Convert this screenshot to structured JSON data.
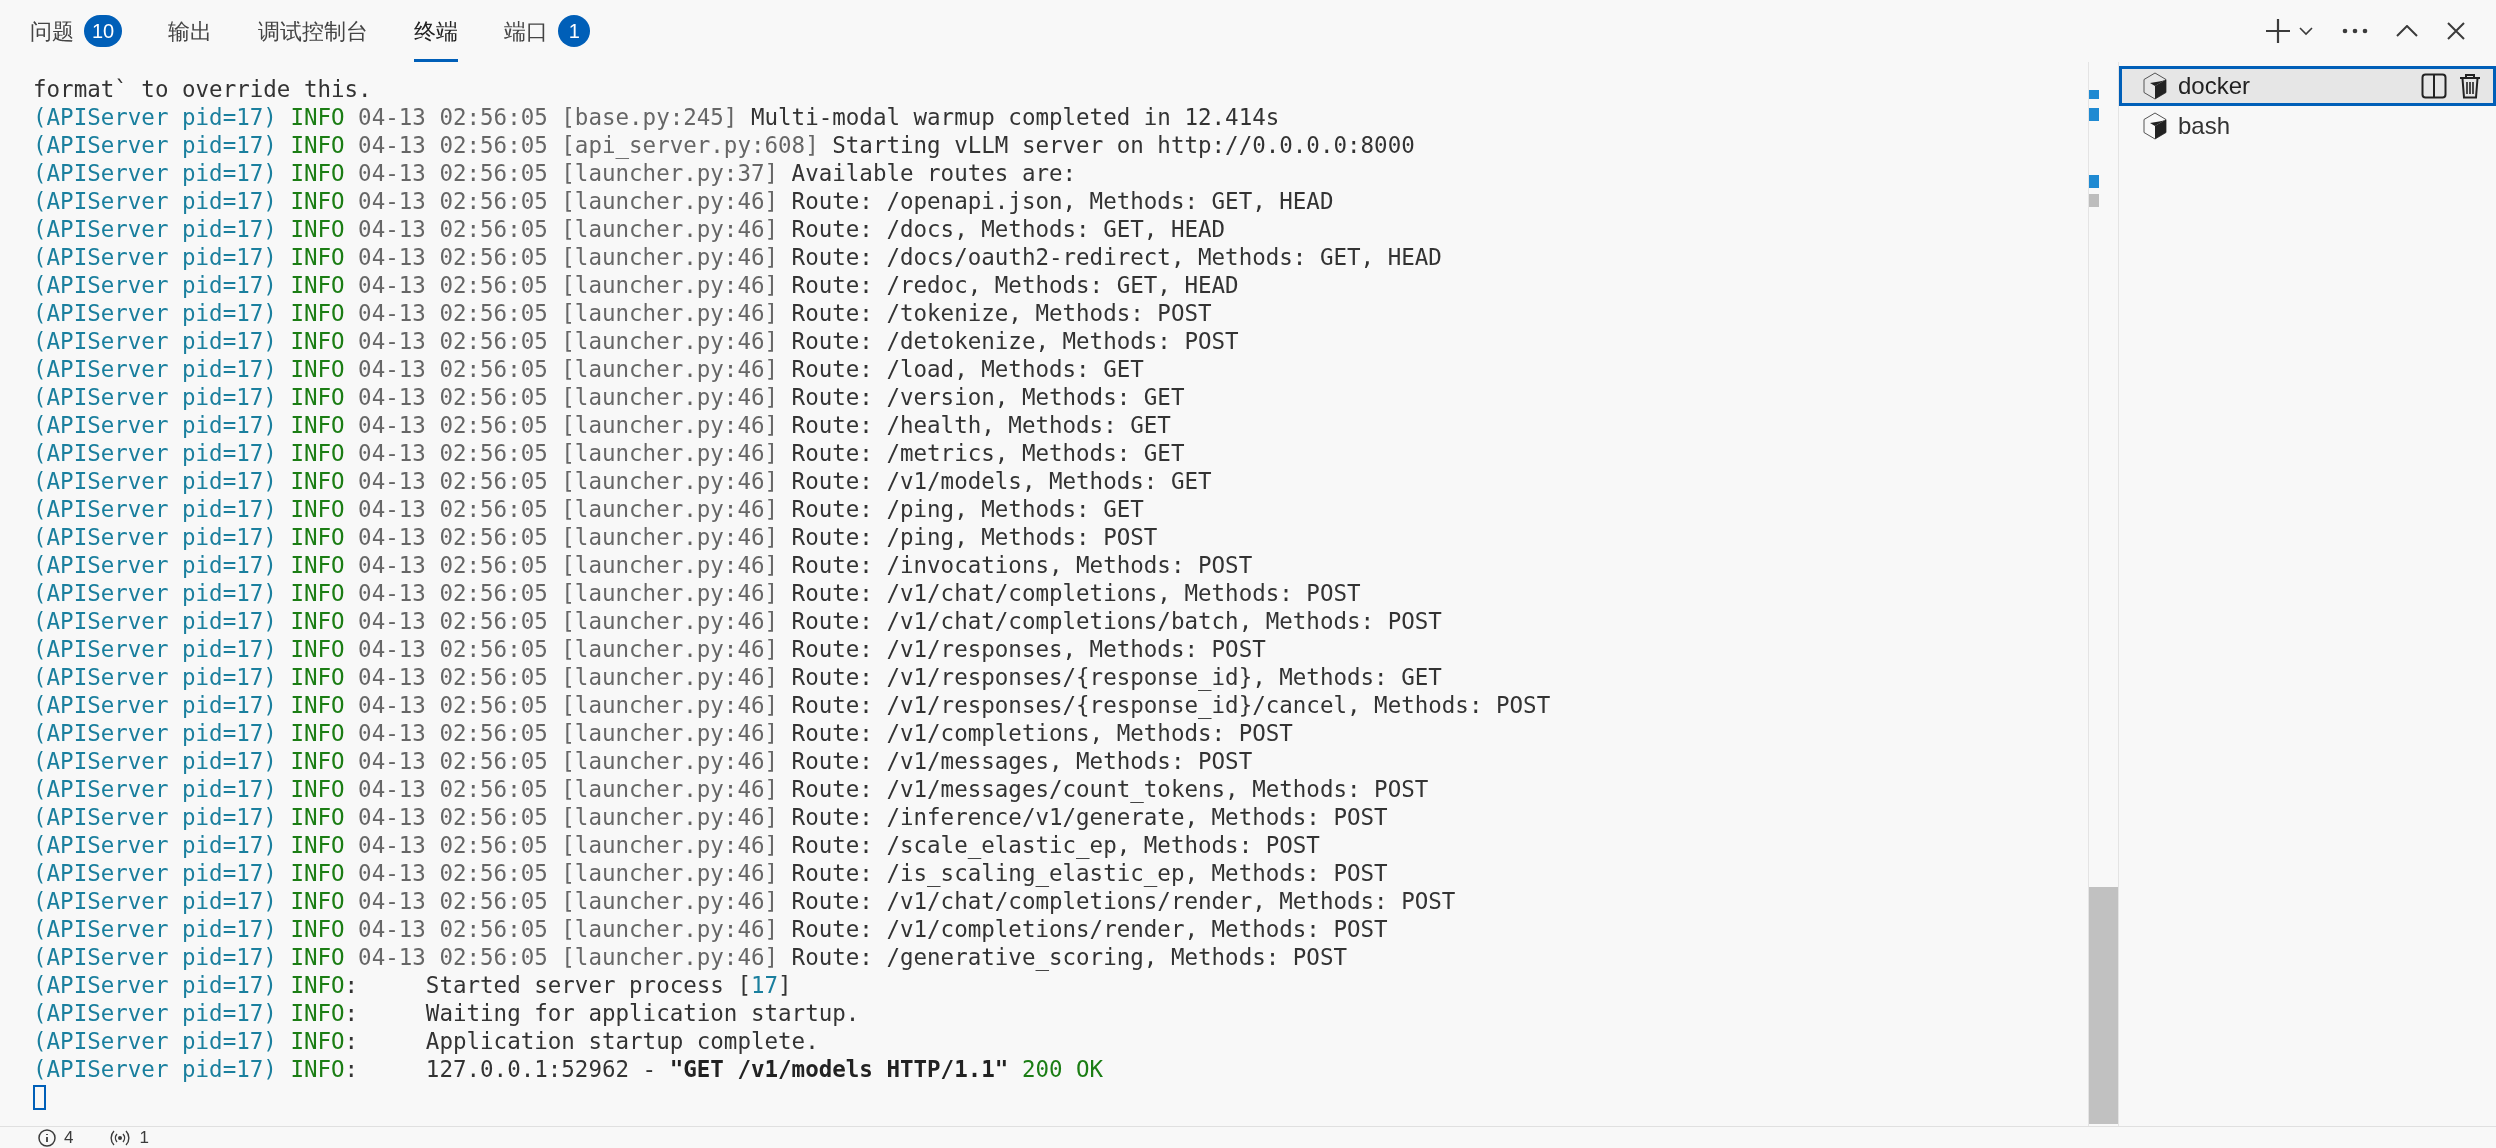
{
  "tabs": [
    {
      "label": "问题",
      "badge": "10",
      "selected": false
    },
    {
      "label": "输出",
      "selected": false
    },
    {
      "label": "调试控制台",
      "selected": false
    },
    {
      "label": "终端",
      "selected": true
    },
    {
      "label": "端口",
      "badge": "1",
      "selected": false
    }
  ],
  "terminal": {
    "lines": [
      [
        {
          "kind": "text",
          "text": "format` to override this."
        }
      ],
      [
        {
          "kind": "prefix",
          "text": "(APIServer pid=17) "
        },
        {
          "kind": "level",
          "text": "INFO"
        },
        {
          "kind": "meta",
          "text": " 04-13 02:56:05 [base.py:245]"
        },
        {
          "kind": "text",
          "text": " Multi-modal warmup completed in 12.414s"
        }
      ],
      [
        {
          "kind": "prefix",
          "text": "(APIServer pid=17) "
        },
        {
          "kind": "level",
          "text": "INFO"
        },
        {
          "kind": "meta",
          "text": " 04-13 02:56:05 [api_server.py:608]"
        },
        {
          "kind": "text",
          "text": " Starting vLLM server on http://0.0.0.0:8000"
        }
      ],
      [
        {
          "kind": "prefix",
          "text": "(APIServer pid=17) "
        },
        {
          "kind": "level",
          "text": "INFO"
        },
        {
          "kind": "meta",
          "text": " 04-13 02:56:05 [launcher.py:37]"
        },
        {
          "kind": "text",
          "text": " Available routes are:"
        }
      ],
      [
        {
          "kind": "prefix",
          "text": "(APIServer pid=17) "
        },
        {
          "kind": "level",
          "text": "INFO"
        },
        {
          "kind": "meta",
          "text": " 04-13 02:56:05 [launcher.py:46]"
        },
        {
          "kind": "text",
          "text": " Route: /openapi.json, Methods: GET, HEAD"
        }
      ],
      [
        {
          "kind": "prefix",
          "text": "(APIServer pid=17) "
        },
        {
          "kind": "level",
          "text": "INFO"
        },
        {
          "kind": "meta",
          "text": " 04-13 02:56:05 [launcher.py:46]"
        },
        {
          "kind": "text",
          "text": " Route: /docs, Methods: GET, HEAD"
        }
      ],
      [
        {
          "kind": "prefix",
          "text": "(APIServer pid=17) "
        },
        {
          "kind": "level",
          "text": "INFO"
        },
        {
          "kind": "meta",
          "text": " 04-13 02:56:05 [launcher.py:46]"
        },
        {
          "kind": "text",
          "text": " Route: /docs/oauth2-redirect, Methods: GET, HEAD"
        }
      ],
      [
        {
          "kind": "prefix",
          "text": "(APIServer pid=17) "
        },
        {
          "kind": "level",
          "text": "INFO"
        },
        {
          "kind": "meta",
          "text": " 04-13 02:56:05 [launcher.py:46]"
        },
        {
          "kind": "text",
          "text": " Route: /redoc, Methods: GET, HEAD"
        }
      ],
      [
        {
          "kind": "prefix",
          "text": "(APIServer pid=17) "
        },
        {
          "kind": "level",
          "text": "INFO"
        },
        {
          "kind": "meta",
          "text": " 04-13 02:56:05 [launcher.py:46]"
        },
        {
          "kind": "text",
          "text": " Route: /tokenize, Methods: POST"
        }
      ],
      [
        {
          "kind": "prefix",
          "text": "(APIServer pid=17) "
        },
        {
          "kind": "level",
          "text": "INFO"
        },
        {
          "kind": "meta",
          "text": " 04-13 02:56:05 [launcher.py:46]"
        },
        {
          "kind": "text",
          "text": " Route: /detokenize, Methods: POST"
        }
      ],
      [
        {
          "kind": "prefix",
          "text": "(APIServer pid=17) "
        },
        {
          "kind": "level",
          "text": "INFO"
        },
        {
          "kind": "meta",
          "text": " 04-13 02:56:05 [launcher.py:46]"
        },
        {
          "kind": "text",
          "text": " Route: /load, Methods: GET"
        }
      ],
      [
        {
          "kind": "prefix",
          "text": "(APIServer pid=17) "
        },
        {
          "kind": "level",
          "text": "INFO"
        },
        {
          "kind": "meta",
          "text": " 04-13 02:56:05 [launcher.py:46]"
        },
        {
          "kind": "text",
          "text": " Route: /version, Methods: GET"
        }
      ],
      [
        {
          "kind": "prefix",
          "text": "(APIServer pid=17) "
        },
        {
          "kind": "level",
          "text": "INFO"
        },
        {
          "kind": "meta",
          "text": " 04-13 02:56:05 [launcher.py:46]"
        },
        {
          "kind": "text",
          "text": " Route: /health, Methods: GET"
        }
      ],
      [
        {
          "kind": "prefix",
          "text": "(APIServer pid=17) "
        },
        {
          "kind": "level",
          "text": "INFO"
        },
        {
          "kind": "meta",
          "text": " 04-13 02:56:05 [launcher.py:46]"
        },
        {
          "kind": "text",
          "text": " Route: /metrics, Methods: GET"
        }
      ],
      [
        {
          "kind": "prefix",
          "text": "(APIServer pid=17) "
        },
        {
          "kind": "level",
          "text": "INFO"
        },
        {
          "kind": "meta",
          "text": " 04-13 02:56:05 [launcher.py:46]"
        },
        {
          "kind": "text",
          "text": " Route: /v1/models, Methods: GET"
        }
      ],
      [
        {
          "kind": "prefix",
          "text": "(APIServer pid=17) "
        },
        {
          "kind": "level",
          "text": "INFO"
        },
        {
          "kind": "meta",
          "text": " 04-13 02:56:05 [launcher.py:46]"
        },
        {
          "kind": "text",
          "text": " Route: /ping, Methods: GET"
        }
      ],
      [
        {
          "kind": "prefix",
          "text": "(APIServer pid=17) "
        },
        {
          "kind": "level",
          "text": "INFO"
        },
        {
          "kind": "meta",
          "text": " 04-13 02:56:05 [launcher.py:46]"
        },
        {
          "kind": "text",
          "text": " Route: /ping, Methods: POST"
        }
      ],
      [
        {
          "kind": "prefix",
          "text": "(APIServer pid=17) "
        },
        {
          "kind": "level",
          "text": "INFO"
        },
        {
          "kind": "meta",
          "text": " 04-13 02:56:05 [launcher.py:46]"
        },
        {
          "kind": "text",
          "text": " Route: /invocations, Methods: POST"
        }
      ],
      [
        {
          "kind": "prefix",
          "text": "(APIServer pid=17) "
        },
        {
          "kind": "level",
          "text": "INFO"
        },
        {
          "kind": "meta",
          "text": " 04-13 02:56:05 [launcher.py:46]"
        },
        {
          "kind": "text",
          "text": " Route: /v1/chat/completions, Methods: POST"
        }
      ],
      [
        {
          "kind": "prefix",
          "text": "(APIServer pid=17) "
        },
        {
          "kind": "level",
          "text": "INFO"
        },
        {
          "kind": "meta",
          "text": " 04-13 02:56:05 [launcher.py:46]"
        },
        {
          "kind": "text",
          "text": " Route: /v1/chat/completions/batch, Methods: POST"
        }
      ],
      [
        {
          "kind": "prefix",
          "text": "(APIServer pid=17) "
        },
        {
          "kind": "level",
          "text": "INFO"
        },
        {
          "kind": "meta",
          "text": " 04-13 02:56:05 [launcher.py:46]"
        },
        {
          "kind": "text",
          "text": " Route: /v1/responses, Methods: POST"
        }
      ],
      [
        {
          "kind": "prefix",
          "text": "(APIServer pid=17) "
        },
        {
          "kind": "level",
          "text": "INFO"
        },
        {
          "kind": "meta",
          "text": " 04-13 02:56:05 [launcher.py:46]"
        },
        {
          "kind": "text",
          "text": " Route: /v1/responses/{response_id}, Methods: GET"
        }
      ],
      [
        {
          "kind": "prefix",
          "text": "(APIServer pid=17) "
        },
        {
          "kind": "level",
          "text": "INFO"
        },
        {
          "kind": "meta",
          "text": " 04-13 02:56:05 [launcher.py:46]"
        },
        {
          "kind": "text",
          "text": " Route: /v1/responses/{response_id}/cancel, Methods: POST"
        }
      ],
      [
        {
          "kind": "prefix",
          "text": "(APIServer pid=17) "
        },
        {
          "kind": "level",
          "text": "INFO"
        },
        {
          "kind": "meta",
          "text": " 04-13 02:56:05 [launcher.py:46]"
        },
        {
          "kind": "text",
          "text": " Route: /v1/completions, Methods: POST"
        }
      ],
      [
        {
          "kind": "prefix",
          "text": "(APIServer pid=17) "
        },
        {
          "kind": "level",
          "text": "INFO"
        },
        {
          "kind": "meta",
          "text": " 04-13 02:56:05 [launcher.py:46]"
        },
        {
          "kind": "text",
          "text": " Route: /v1/messages, Methods: POST"
        }
      ],
      [
        {
          "kind": "prefix",
          "text": "(APIServer pid=17) "
        },
        {
          "kind": "level",
          "text": "INFO"
        },
        {
          "kind": "meta",
          "text": " 04-13 02:56:05 [launcher.py:46]"
        },
        {
          "kind": "text",
          "text": " Route: /v1/messages/count_tokens, Methods: POST"
        }
      ],
      [
        {
          "kind": "prefix",
          "text": "(APIServer pid=17) "
        },
        {
          "kind": "level",
          "text": "INFO"
        },
        {
          "kind": "meta",
          "text": " 04-13 02:56:05 [launcher.py:46]"
        },
        {
          "kind": "text",
          "text": " Route: /inference/v1/generate, Methods: POST"
        }
      ],
      [
        {
          "kind": "prefix",
          "text": "(APIServer pid=17) "
        },
        {
          "kind": "level",
          "text": "INFO"
        },
        {
          "kind": "meta",
          "text": " 04-13 02:56:05 [launcher.py:46]"
        },
        {
          "kind": "text",
          "text": " Route: /scale_elastic_ep, Methods: POST"
        }
      ],
      [
        {
          "kind": "prefix",
          "text": "(APIServer pid=17) "
        },
        {
          "kind": "level",
          "text": "INFO"
        },
        {
          "kind": "meta",
          "text": " 04-13 02:56:05 [launcher.py:46]"
        },
        {
          "kind": "text",
          "text": " Route: /is_scaling_elastic_ep, Methods: POST"
        }
      ],
      [
        {
          "kind": "prefix",
          "text": "(APIServer pid=17) "
        },
        {
          "kind": "level",
          "text": "INFO"
        },
        {
          "kind": "meta",
          "text": " 04-13 02:56:05 [launcher.py:46]"
        },
        {
          "kind": "text",
          "text": " Route: /v1/chat/completions/render, Methods: POST"
        }
      ],
      [
        {
          "kind": "prefix",
          "text": "(APIServer pid=17) "
        },
        {
          "kind": "level",
          "text": "INFO"
        },
        {
          "kind": "meta",
          "text": " 04-13 02:56:05 [launcher.py:46]"
        },
        {
          "kind": "text",
          "text": " Route: /v1/completions/render, Methods: POST"
        }
      ],
      [
        {
          "kind": "prefix",
          "text": "(APIServer pid=17) "
        },
        {
          "kind": "level",
          "text": "INFO"
        },
        {
          "kind": "meta",
          "text": " 04-13 02:56:05 [launcher.py:46]"
        },
        {
          "kind": "text",
          "text": " Route: /generative_scoring, Methods: POST"
        }
      ],
      [
        {
          "kind": "prefix",
          "text": "(APIServer pid=17) "
        },
        {
          "kind": "level",
          "text": "INFO"
        },
        {
          "kind": "text",
          "text": ":     Started server process ["
        },
        {
          "kind": "number",
          "text": "17"
        },
        {
          "kind": "text",
          "text": "]"
        }
      ],
      [
        {
          "kind": "prefix",
          "text": "(APIServer pid=17) "
        },
        {
          "kind": "level",
          "text": "INFO"
        },
        {
          "kind": "text",
          "text": ":     Waiting for application startup."
        }
      ],
      [
        {
          "kind": "prefix",
          "text": "(APIServer pid=17) "
        },
        {
          "kind": "level",
          "text": "INFO"
        },
        {
          "kind": "text",
          "text": ":     Application startup complete."
        }
      ],
      [
        {
          "kind": "prefix",
          "text": "(APIServer pid=17) "
        },
        {
          "kind": "level",
          "text": "INFO"
        },
        {
          "kind": "text",
          "text": ":     127.0.0.1:52962 - "
        },
        {
          "kind": "bold",
          "text": "\"GET /v1/models HTTP/1.1\""
        },
        {
          "kind": "level",
          "text": " 200 OK"
        }
      ]
    ]
  },
  "terminals": [
    {
      "label": "docker",
      "selected": true
    },
    {
      "label": "bash",
      "selected": false
    }
  ],
  "status_bar": [
    {
      "kind": "info",
      "text": "4"
    },
    {
      "kind": "ports",
      "text": "1"
    }
  ]
}
